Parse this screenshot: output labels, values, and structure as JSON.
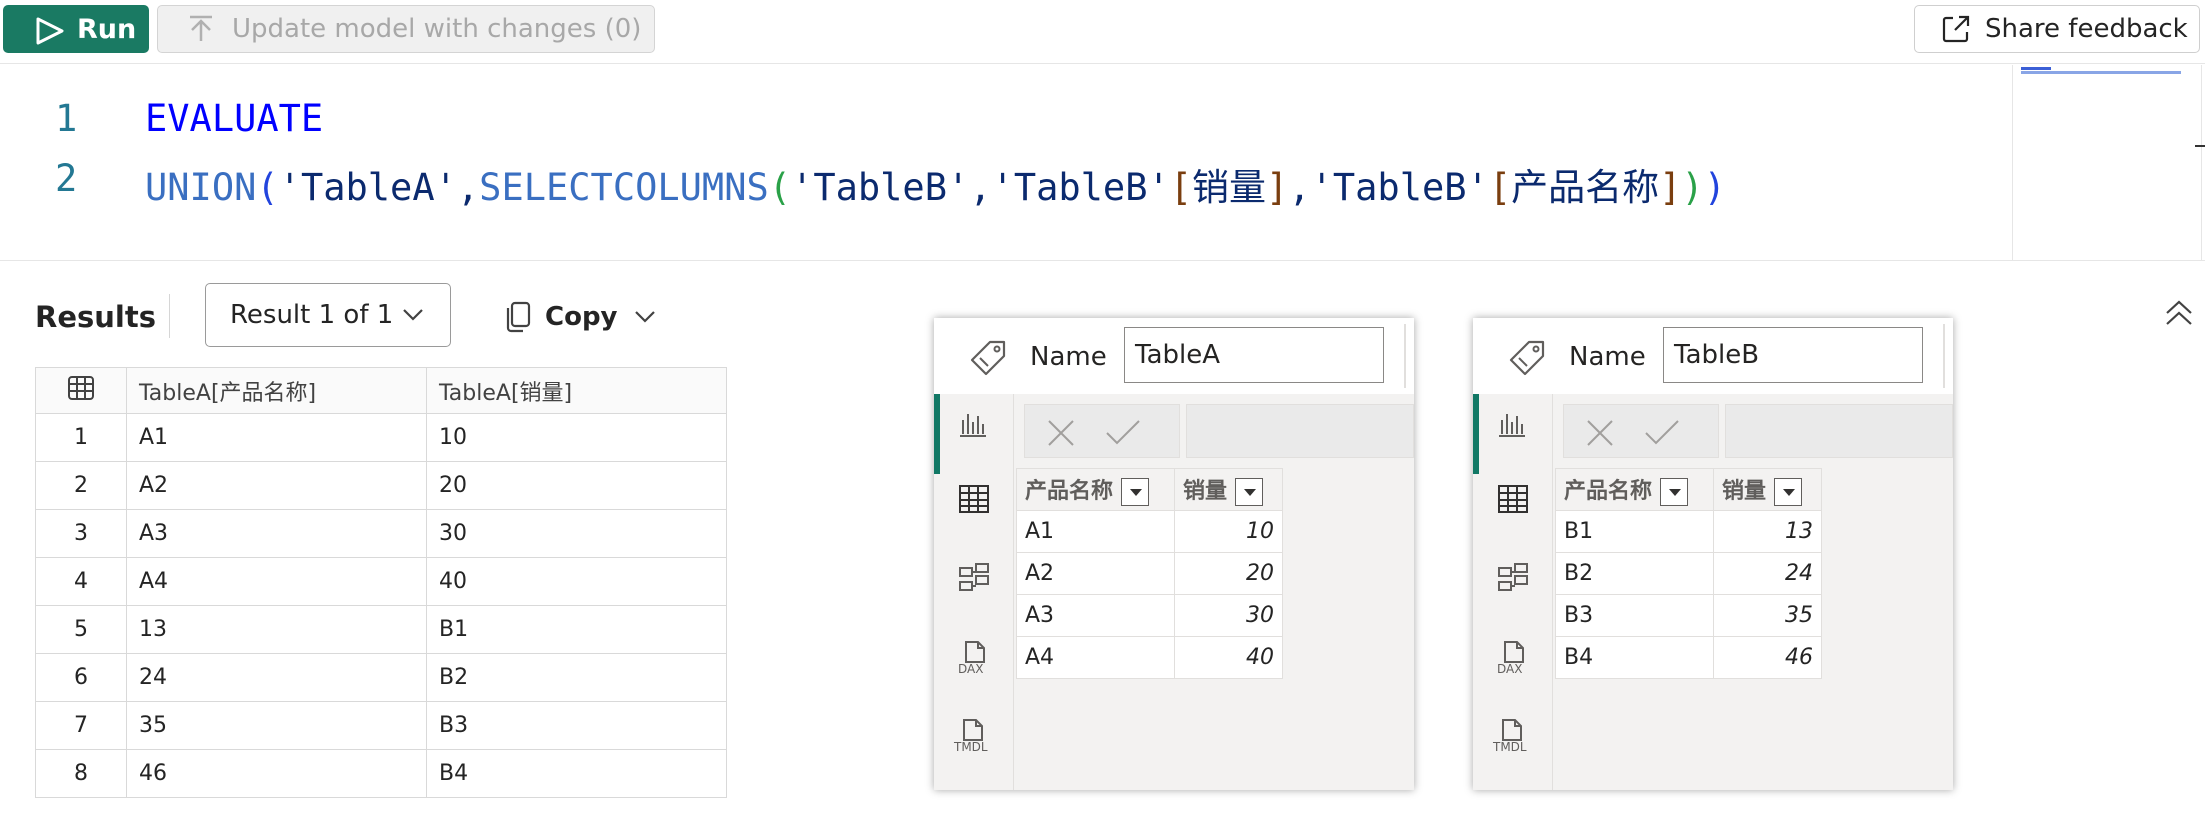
{
  "toolbar": {
    "run_label": "Run",
    "update_label": "Update model with changes (0)",
    "share_label": "Share feedback"
  },
  "editor": {
    "lines": [
      {
        "number": "1",
        "text": "EVALUATE"
      },
      {
        "number": "2",
        "text": "UNION('TableA',SELECTCOLUMNS('TableB','TableB'[销量],'TableB'[产品名称]))"
      }
    ]
  },
  "results": {
    "title": "Results",
    "selector": "Result 1 of 1",
    "copy_label": "Copy",
    "columns": [
      "TableA[产品名称]",
      "TableA[销量]"
    ],
    "rows": [
      {
        "n": "1",
        "a": "A1",
        "b": "10"
      },
      {
        "n": "2",
        "a": "A2",
        "b": "20"
      },
      {
        "n": "3",
        "a": "A3",
        "b": "30"
      },
      {
        "n": "4",
        "a": "A4",
        "b": "40"
      },
      {
        "n": "5",
        "a": "13",
        "b": "B1"
      },
      {
        "n": "6",
        "a": "24",
        "b": "B2"
      },
      {
        "n": "7",
        "a": "35",
        "b": "B3"
      },
      {
        "n": "8",
        "a": "46",
        "b": "B4"
      }
    ]
  },
  "panels": [
    {
      "name_label": "Name",
      "name_value": "TableA",
      "columns": [
        "产品名称",
        "销量"
      ],
      "rows": [
        [
          "A1",
          "10"
        ],
        [
          "A2",
          "20"
        ],
        [
          "A3",
          "30"
        ],
        [
          "A4",
          "40"
        ]
      ]
    },
    {
      "name_label": "Name",
      "name_value": "TableB",
      "columns": [
        "产品名称",
        "销量"
      ],
      "rows": [
        [
          "B1",
          "13"
        ],
        [
          "B2",
          "24"
        ],
        [
          "B3",
          "35"
        ],
        [
          "B4",
          "46"
        ]
      ]
    }
  ],
  "rail_labels": {
    "dax": "DAX",
    "tmdl": "TMDL"
  },
  "icons": {
    "run": "play-icon",
    "update": "arrow-up-icon",
    "share": "external-link-icon",
    "copy": "copy-icon",
    "collapse": "chevron-double-up-icon",
    "grid_corner": "table-grid-icon",
    "panel_name": "tag-icon",
    "rail": [
      "report-view-icon",
      "table-view-icon",
      "model-view-icon",
      "dax-query-icon",
      "tmdl-view-icon"
    ]
  },
  "colors": {
    "run_button": "#1a7a63",
    "active_rail": "#117865",
    "keyword": "#0000ff",
    "function": "#3a6fc1",
    "line_number": "#237893"
  }
}
